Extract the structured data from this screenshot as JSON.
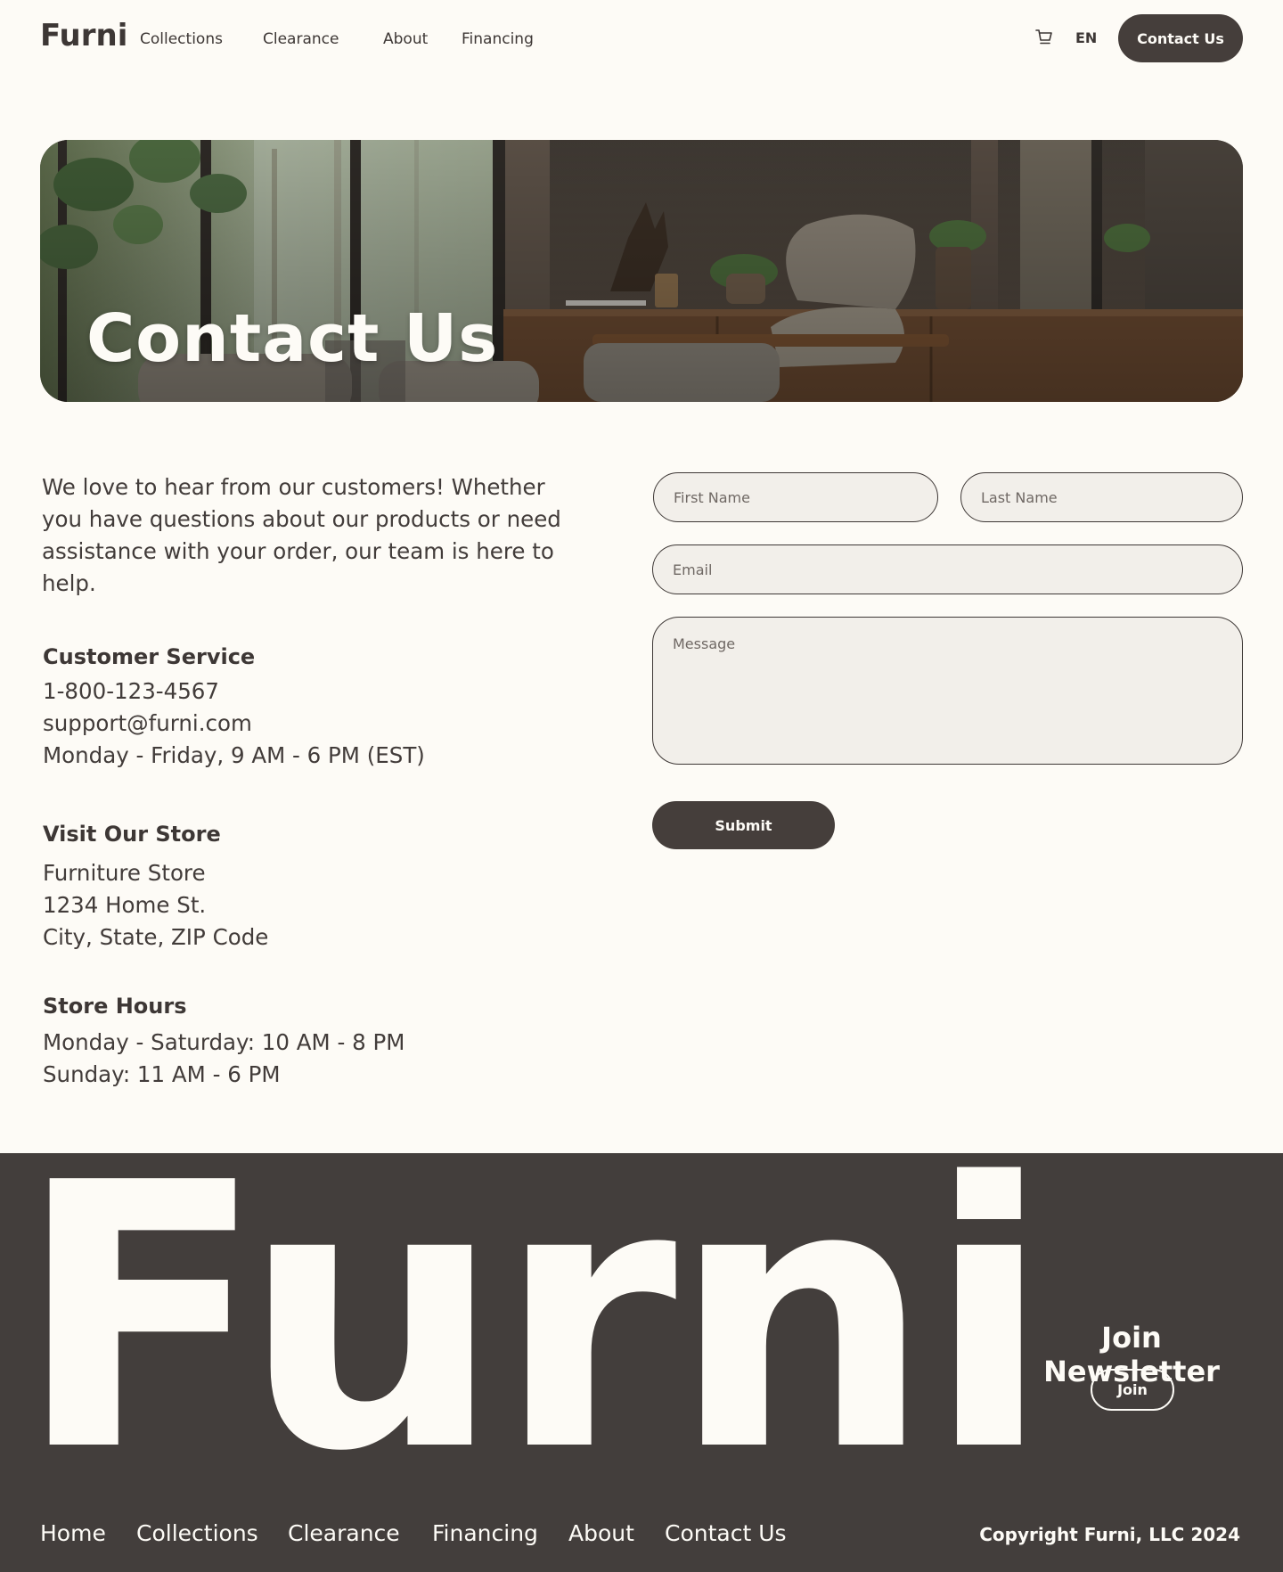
{
  "header": {
    "logo": "Furni",
    "nav": [
      "Collections",
      "Clearance",
      "About",
      "Financing"
    ],
    "cart_icon": "cart-icon",
    "language": "EN",
    "cta_label": "Contact Us"
  },
  "hero": {
    "title": "Contact Us"
  },
  "intro": {
    "text": "We love to hear from our customers! Whether you have questions about our products or need assistance with your order, our team is here to help."
  },
  "customer_service": {
    "heading": "Customer Service",
    "phone": "1-800-123-4567",
    "email": "support@furni.com",
    "hours": "Monday - Friday, 9 AM - 6 PM (EST)"
  },
  "store": {
    "heading": "Visit Our Store",
    "name": "Furniture Store",
    "street": "1234 Home St.",
    "city": "City, State, ZIP Code"
  },
  "store_hours": {
    "heading": "Store Hours",
    "weekdays": "Monday - Saturday: 10 AM - 8 PM",
    "sunday": "Sunday: 11 AM - 6 PM"
  },
  "form": {
    "first_name_placeholder": "First Name",
    "last_name_placeholder": "Last Name",
    "email_placeholder": "Email",
    "message_placeholder": "Message",
    "submit_label": "Submit"
  },
  "footer": {
    "big_logo": "Furni",
    "newsletter_title": "Join Newsletter",
    "join_label": "Join",
    "links": [
      "Home",
      "Collections",
      "Clearance",
      "Financing",
      "About",
      "Contact Us"
    ],
    "copyright": "Copyright Furni, LLC 2024"
  },
  "colors": {
    "background": "#fdfbf6",
    "dark": "#433e3c",
    "field_bg": "#f2efea"
  }
}
